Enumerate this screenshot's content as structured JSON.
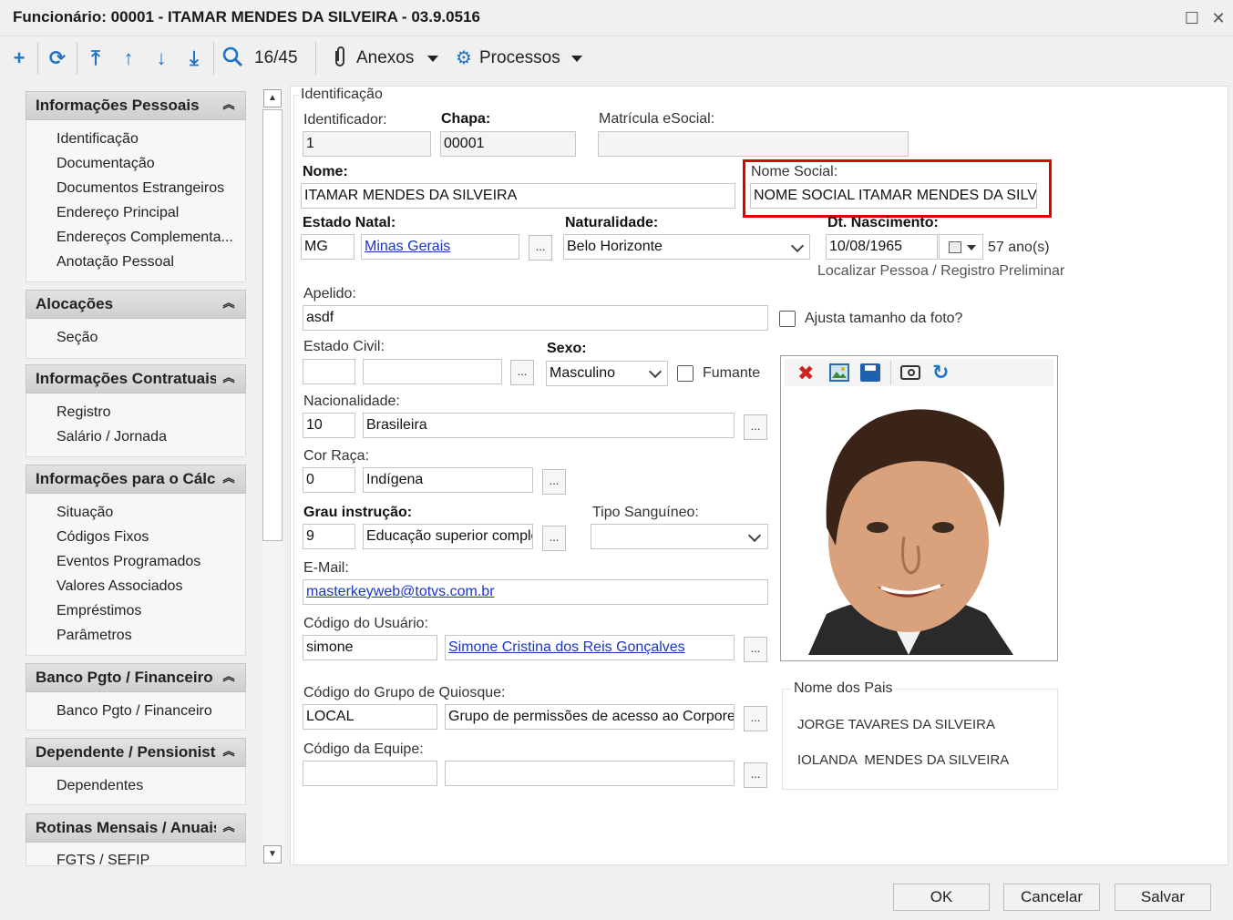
{
  "window": {
    "title": "Funcionário: 00001 - ITAMAR MENDES DA SILVEIRA - 03.9.0516"
  },
  "toolbar": {
    "record_position": "16/45",
    "attachments_label": "Anexos",
    "processes_label": "Processos"
  },
  "sidebar": {
    "sections": [
      {
        "title": "Informações Pessoais",
        "items": [
          "Identificação",
          "Documentação",
          "Documentos Estrangeiros",
          "Endereço Principal",
          "Endereços Complementa...",
          "Anotação Pessoal"
        ]
      },
      {
        "title": "Alocações",
        "items": [
          "Seção"
        ]
      },
      {
        "title": "Informações Contratuais",
        "items": [
          "Registro",
          "Salário / Jornada"
        ]
      },
      {
        "title": "Informações para o Cálculo",
        "items": [
          "Situação",
          "Códigos Fixos",
          "Eventos Programados",
          "Valores Associados",
          "Empréstimos",
          "Parâmetros"
        ]
      },
      {
        "title": "Banco Pgto / Financeiro",
        "items": [
          "Banco Pgto / Financeiro"
        ]
      },
      {
        "title": "Dependente / Pensionista",
        "items": [
          "Dependentes"
        ]
      },
      {
        "title": "Rotinas Mensais / Anuais",
        "items": [
          "FGTS / SEFIP"
        ]
      }
    ]
  },
  "form": {
    "group_title": "Identificação",
    "identificador": {
      "label": "Identificador:",
      "value": "1"
    },
    "chapa": {
      "label": "Chapa:",
      "value": "00001"
    },
    "matricula": {
      "label": "Matrícula eSocial:",
      "value": ""
    },
    "nome": {
      "label": "Nome:",
      "value": "ITAMAR MENDES DA SILVEIRA"
    },
    "nome_social": {
      "label": "Nome Social:",
      "value": "NOME SOCIAL ITAMAR MENDES DA SILVEIRA"
    },
    "estado_natal": {
      "label": "Estado Natal:",
      "code": "MG",
      "name": "Minas Gerais"
    },
    "naturalidade": {
      "label": "Naturalidade:",
      "value": "Belo Horizonte"
    },
    "dt_nascimento": {
      "label": "Dt. Nascimento:",
      "value": "10/08/1965",
      "age": "57 ano(s)"
    },
    "localizar_pessoa": "Localizar Pessoa / Registro Preliminar",
    "apelido": {
      "label": "Apelido:",
      "value": "asdf"
    },
    "ajusta_foto": {
      "label": "Ajusta tamanho da foto?",
      "checked": false
    },
    "estado_civil": {
      "label": "Estado Civil:",
      "code": "",
      "name": ""
    },
    "sexo": {
      "label": "Sexo:",
      "value": "Masculino"
    },
    "fumante": {
      "label": "Fumante",
      "checked": false
    },
    "nacionalidade": {
      "label": "Nacionalidade:",
      "code": "10",
      "name": "Brasileira"
    },
    "cor_raca": {
      "label": "Cor Raça:",
      "code": "0",
      "name": "Indígena"
    },
    "grau_instrucao": {
      "label": "Grau instrução:",
      "code": "9",
      "name": "Educação superior completa"
    },
    "tipo_sanguineo": {
      "label": "Tipo Sanguíneo:",
      "value": ""
    },
    "email": {
      "label": "E-Mail:",
      "value": "masterkeyweb@totvs.com.br"
    },
    "codigo_usuario": {
      "label": "Código do Usuário:",
      "code": "simone",
      "name": "Simone Cristina dos Reis Gonçalves"
    },
    "grupo_quiosque": {
      "label": "Código do Grupo de Quiosque:",
      "code": "LOCAL",
      "name": "Grupo de permissões de acesso ao Corporel"
    },
    "equipe": {
      "label": "Código da Equipe:",
      "code": "",
      "name": ""
    },
    "browse_label": "...",
    "pais": {
      "title": "Nome dos Pais",
      "father": "JORGE TAVARES DA SILVEIRA",
      "mother": "IOLANDA  MENDES DA SILVEIRA"
    }
  },
  "buttons": {
    "ok": "OK",
    "cancel": "Cancelar",
    "save": "Salvar"
  },
  "colors": {
    "accent": "#1f74c8",
    "highlight": "#e00000",
    "link": "#1a36c8"
  }
}
